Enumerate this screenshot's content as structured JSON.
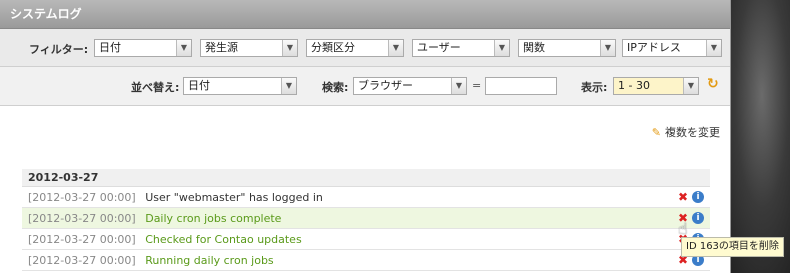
{
  "title": "システムログ",
  "filters": {
    "label": "フィルター:",
    "selects": [
      "日付",
      "発生源",
      "分類区分",
      "ユーザー",
      "関数",
      "IPアドレス"
    ]
  },
  "sort": {
    "label": "並べ替え:",
    "value": "日付"
  },
  "search": {
    "label": "検索:",
    "field": "ブラウザー",
    "equals": "=",
    "value": ""
  },
  "display": {
    "label": "表示:",
    "value": "1 - 30"
  },
  "change_multiple": "複数を変更",
  "date_group": "2012-03-27",
  "rows": [
    {
      "time": "[2012-03-27 00:00]",
      "message": "User \"webmaster\" has logged in",
      "style": "plain"
    },
    {
      "time": "[2012-03-27 00:00]",
      "message": "Daily cron jobs complete",
      "style": "green"
    },
    {
      "time": "[2012-03-27 00:00]",
      "message": "Checked for Contao updates",
      "style": "green"
    },
    {
      "time": "[2012-03-27 00:00]",
      "message": "Running daily cron jobs",
      "style": "green"
    }
  ],
  "tooltip": "ID 163の項目を削除",
  "icons": {
    "delete": "delete-icon",
    "info": "info-icon",
    "refresh": "refresh-icon",
    "edit": "edit-multiple-icon",
    "cursor": "hand-cursor-icon"
  },
  "colors": {
    "accent": "#e39a12",
    "green_text": "#5a9a1a",
    "delete_red": "#dd2222",
    "info_blue": "#3b7dc9"
  }
}
